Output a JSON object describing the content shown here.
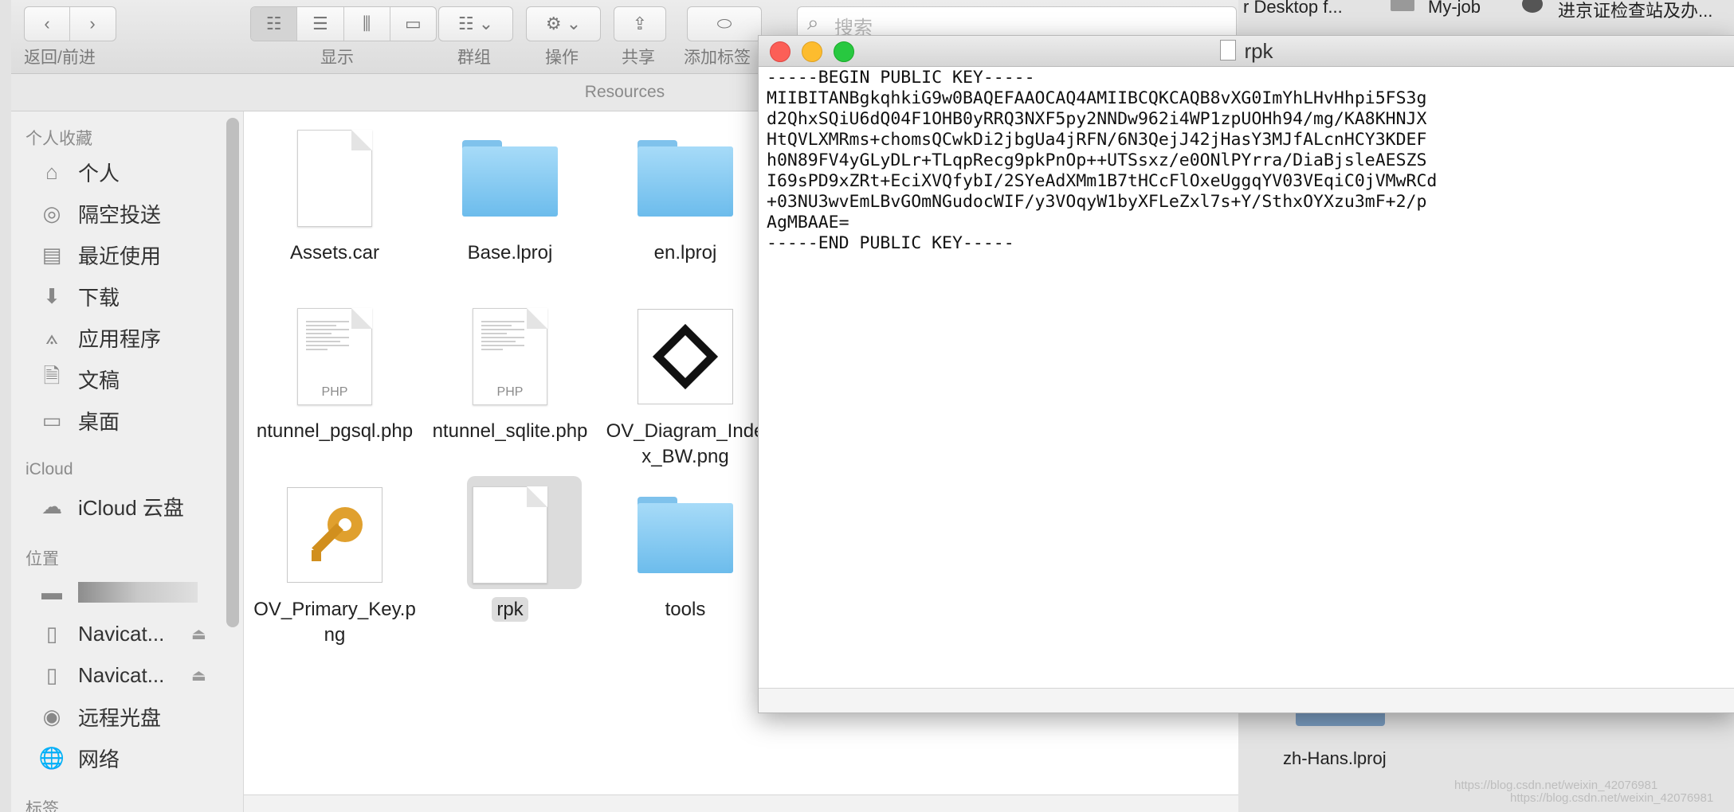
{
  "desktop": {
    "top_items": [
      "r Desktop f...",
      "My-job",
      "进京证检查站及办..."
    ],
    "folder_label": "zh-Hans.lproj",
    "watermark_1": "https://blog.csdn.net/weixin_42076981",
    "watermark_2": "https://blog.csdn.net/weixin_42076981"
  },
  "finder": {
    "toolbar": {
      "back_forward_label": "返回/前进",
      "view_label": "显示",
      "group_label": "群组",
      "action_label": "操作",
      "share_label": "共享",
      "tag_label": "添加标签",
      "search_placeholder": "搜索"
    },
    "path_title": "Resources",
    "sidebar": {
      "favorites_heading": "个人收藏",
      "favorites": [
        {
          "label": "个人",
          "icon": "home-icon"
        },
        {
          "label": "隔空投送",
          "icon": "airdrop-icon"
        },
        {
          "label": "最近使用",
          "icon": "recents-icon"
        },
        {
          "label": "下载",
          "icon": "downloads-icon"
        },
        {
          "label": "应用程序",
          "icon": "applications-icon"
        },
        {
          "label": "文稿",
          "icon": "documents-icon"
        },
        {
          "label": "桌面",
          "icon": "desktop-icon"
        }
      ],
      "icloud_heading": "iCloud",
      "icloud_drive": "iCloud 云盘",
      "locations_heading": "位置",
      "locations": [
        {
          "label": "Navicat...",
          "icon": "disk-icon"
        },
        {
          "label": "Navicat...",
          "icon": "disk-icon"
        },
        {
          "label": "远程光盘",
          "icon": "remote-disc-icon"
        },
        {
          "label": "网络",
          "icon": "network-icon"
        }
      ],
      "tags_heading": "标签"
    },
    "files": [
      {
        "name": "Assets.car",
        "kind": "document"
      },
      {
        "name": "Base.lproj",
        "kind": "folder"
      },
      {
        "name": "en.lproj",
        "kind": "folder"
      },
      {
        "name": "ntunnel_pgsql.php",
        "kind": "php",
        "tag": "PHP"
      },
      {
        "name": "ntunnel_sqlite.php",
        "kind": "php",
        "tag": "PHP"
      },
      {
        "name": "OV_Diagram_Index_BW.png",
        "kind": "diagram"
      },
      {
        "name": "OV_Primary_Key.png",
        "kind": "key"
      },
      {
        "name": "rpk",
        "kind": "document",
        "selected": true
      },
      {
        "name": "tools",
        "kind": "folder"
      }
    ]
  },
  "textedit": {
    "title": "rpk",
    "content": "-----BEGIN PUBLIC KEY-----\nMIIBITANBgkqhkiG9w0BAQEFAAOCAQ4AMIIBCQKCAQB8vXG0ImYhLHvHhpi5FS3g\nd2QhxSQiU6dQ04F1OHB0yRRQ3NXF5py2NNDw962i4WP1zpUOHh94/mg/KA8KHNJX\nHtQVLXMRms+chomsQCwkDi2jbgUa4jRFN/6N3QejJ42jHasY3MJfALcnHCY3KDEF\nh0N89FV4yGLyDLr+TLqpRecg9pkPnOp++UTSsxz/e0ONlPYrra/DiaBjsleAESZS\nI69sPD9xZRt+EciXVQfybI/2SYeAdXMm1B7tHCcFlOxeUggqYV03VEqiC0jVMwRCd\n+03NU3wvEmLBvGOmNGudocWIF/y3VOqyW1byXFLeZxl7s+Y/SthxOYXzu3mF+2/p\nAgMBAAE=\n-----END PUBLIC KEY-----"
  }
}
